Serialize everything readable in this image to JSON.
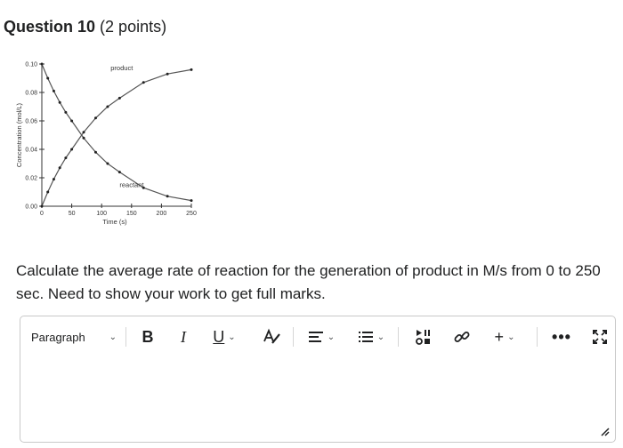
{
  "question": {
    "title": "Question 10",
    "points": "(2 points)",
    "prompt": "Calculate the average rate of reaction for the generation of product in M/s from 0 to 250 sec. Need to show your work to get full marks."
  },
  "chart_data": {
    "type": "line",
    "xlabel": "Time (s)",
    "ylabel": "Concentration (mol/L)",
    "xlim": [
      0,
      250
    ],
    "ylim": [
      0,
      0.1
    ],
    "x_ticks": [
      "0",
      "50",
      "100",
      "150",
      "200",
      "250"
    ],
    "y_ticks": [
      "0.00",
      "0.02",
      "0.04",
      "0.06",
      "0.08",
      "0.10"
    ],
    "grid": false,
    "series": [
      {
        "name": "product",
        "x": [
          0,
          10,
          20,
          30,
          40,
          50,
          70,
          90,
          110,
          130,
          170,
          210,
          250
        ],
        "y": [
          0.0,
          0.01,
          0.019,
          0.027,
          0.034,
          0.04,
          0.052,
          0.062,
          0.07,
          0.076,
          0.087,
          0.093,
          0.096
        ]
      },
      {
        "name": "reactant",
        "x": [
          0,
          10,
          20,
          30,
          40,
          50,
          70,
          90,
          110,
          130,
          170,
          210,
          250
        ],
        "y": [
          0.1,
          0.09,
          0.081,
          0.073,
          0.066,
          0.06,
          0.048,
          0.038,
          0.03,
          0.024,
          0.013,
          0.007,
          0.004
        ]
      }
    ]
  },
  "editor": {
    "format_label": "Paragraph",
    "bold_label": "B",
    "italic_label": "I",
    "underline_label": "U",
    "insert_label": "+",
    "more_label": "•••",
    "chevron": "⌄"
  },
  "colors": {
    "text": "#202122",
    "border": "#c9c9c9",
    "curve": "#555555"
  }
}
